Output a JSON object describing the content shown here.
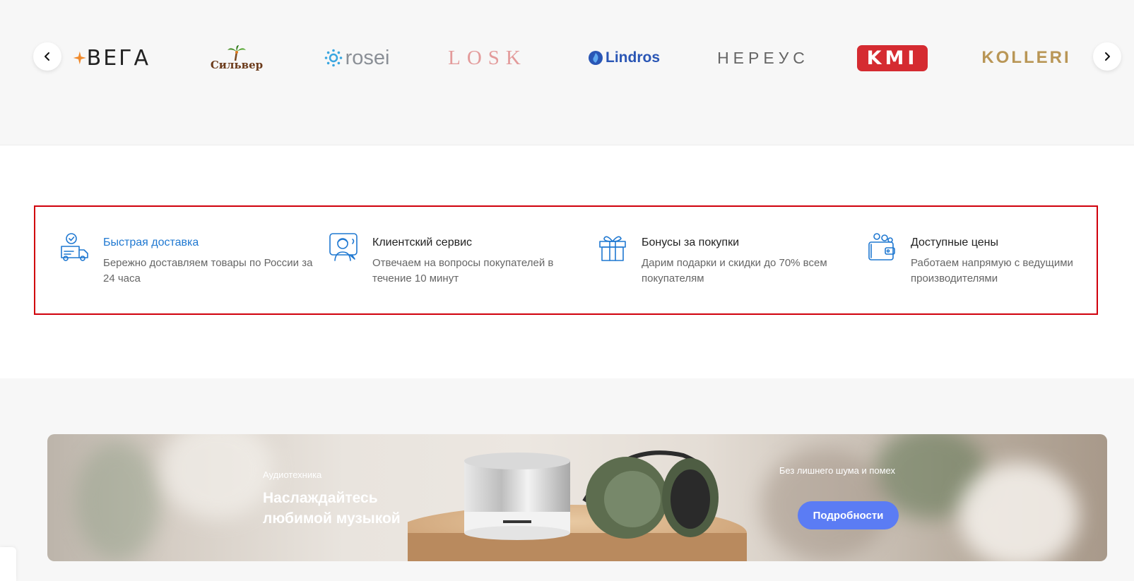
{
  "brands": {
    "prev_icon": "chevron-left-icon",
    "next_icon": "chevron-right-icon",
    "items": [
      {
        "name": "ВЕГА",
        "color": "#222222",
        "accent": "#f08a2c"
      },
      {
        "name": "Сильвер",
        "color": "#6b3a1a",
        "accent": "#3f8a1f"
      },
      {
        "name": "rosei",
        "color": "#8a8f96",
        "accent": "#3aa6e0"
      },
      {
        "name": "LOSK",
        "color": "#e39b9b"
      },
      {
        "name": "Lindros",
        "color": "#2a56b5"
      },
      {
        "name": "НЕРЕУС",
        "color": "#666666"
      },
      {
        "name": "KMI",
        "color": "#d52b31"
      },
      {
        "name": "KOLLERI",
        "color": "#b99656"
      }
    ]
  },
  "features": [
    {
      "icon": "delivery-truck-icon",
      "title": "Быстрая доставка",
      "description": "Бережно доставляем товары по России за 24 часа"
    },
    {
      "icon": "customer-service-icon",
      "title": "Клиентский сервис",
      "description": "Отвечаем на вопросы покупателей в течение 10 минут"
    },
    {
      "icon": "gift-icon",
      "title": "Бонусы за покупки",
      "description": "Дарим подарки и скидки до 70% всем покупателям"
    },
    {
      "icon": "wallet-icon",
      "title": "Доступные цены",
      "description": "Работаем напрямую с ведущими производителями"
    }
  ],
  "banner": {
    "subtitle": "Аудиотехника",
    "title": "Наслаждайтесь любимой музыкой",
    "side_text": "Без лишнего шума и помех",
    "button_label": "Подробности",
    "button_color": "#5b7cf4"
  },
  "colors": {
    "accent": "#1f78d1",
    "highlight_border": "#d0000c",
    "page_bg": "#f7f7f7"
  }
}
